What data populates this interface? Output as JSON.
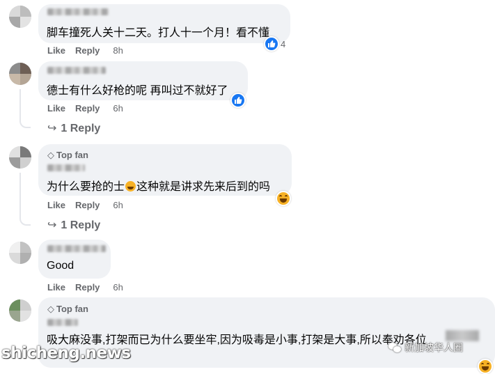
{
  "colors": {
    "bubble": "#f0f2f5",
    "secondary_text": "#65676b",
    "primary_text": "#050505",
    "like_blue": "#1877f2",
    "haha_yellow": "#f7b125"
  },
  "comments": [
    {
      "text": "脚车撞死人关十二天。打人十一个月！看不懂",
      "actions": {
        "like": "Like",
        "reply": "Reply",
        "time": "8h"
      },
      "reactions": {
        "icons": [
          "like-icon"
        ],
        "count": "4"
      }
    },
    {
      "text": "德士有什么好枪的呢 再叫过不就好了",
      "actions": {
        "like": "Like",
        "reply": "Reply",
        "time": "6h"
      },
      "reactions": {
        "icons": [
          "like-icon"
        ]
      },
      "replies_link": "1 Reply"
    },
    {
      "badge": "Top fan",
      "text_before": "为什么要抢的士",
      "text_after": "这种就是讲求先来后到的吗",
      "actions": {
        "like": "Like",
        "reply": "Reply",
        "time": "6h"
      },
      "reactions": {
        "icons": [
          "haha-icon"
        ]
      },
      "replies_link": "1 Reply"
    },
    {
      "text": "Good",
      "actions": {
        "like": "Like",
        "reply": "Reply",
        "time": "6h"
      }
    },
    {
      "badge": "Top fan",
      "text": "吸大麻没事,打架而已为什么要坐牢,因为吸毒是小事,打架是大事,所以奉劝各位",
      "reactions": {
        "icons": [
          "haha-icon"
        ]
      }
    }
  ],
  "watermarks": {
    "left": "shicheng.news",
    "right": "新加坡华人圈"
  }
}
